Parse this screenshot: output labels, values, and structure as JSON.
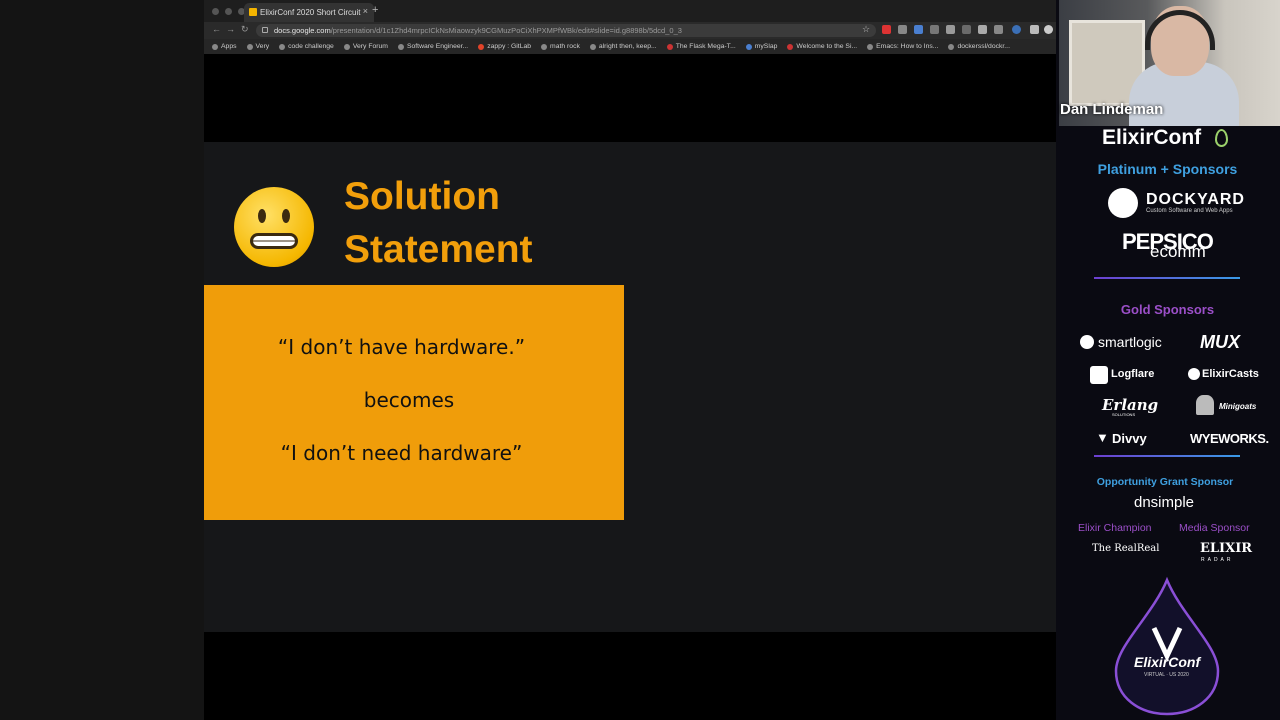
{
  "browser": {
    "tab_title": "ElixirConf 2020 Short Circuit",
    "tab_close": "×",
    "new_tab": "+",
    "url_host": "docs.google.com",
    "url_path": "/presentation/d/1c1Zhd4mrpcICkNsMiaowzyk9CGMuzPoCiXhPXMPfWBk/edit#slide=id.g8898b/5dcd_0_3",
    "bookmarks": [
      "Apps",
      "Very",
      "code challenge",
      "Very Forum",
      "Software Engineer...",
      "zappy : GitLab",
      "math rock",
      "alright then, keep...",
      "The Flask Mega-T...",
      "mySlap",
      "Welcome to the Si...",
      "Emacs: How to Ins...",
      "dockerssl/dockr..."
    ]
  },
  "slide": {
    "title_line1": "Solution",
    "title_line2": "Statement",
    "quote1": "“I don’t have hardware.”",
    "middle": "becomes",
    "quote2": "“I don’t need hardware”",
    "title_color": "#f29f0b",
    "box_color": "#f09d0a"
  },
  "sidebar": {
    "speaker_name": "Dan Lindeman",
    "conf_logo": "ElixirConf",
    "platinum_heading": "Platinum + Sponsors",
    "dockyard": "DOCKYARD",
    "dockyard_tagline": "Custom Software and Web Apps",
    "pepsico": "PEPSICO",
    "ecomm": "ecomm",
    "gold_heading": "Gold Sponsors",
    "gold_sponsors": [
      "smartlogic",
      "MUX",
      "Logflare",
      "ElixirCasts",
      "Erlang",
      "Minigoats",
      "Divvy",
      "WYEWORKS."
    ],
    "erlang_sub": "SOLUTIONS",
    "opportunity_heading": "Opportunity Grant Sponsor",
    "dnsimple": "dnsimple",
    "champion_heading": "Elixir Champion",
    "media_heading": "Media Sponsor",
    "therealreal": "The RealReal",
    "elixir_radar": "ELIXIR",
    "radar_sub": "RADAR",
    "event_logo": "ElixirConf",
    "event_sub": "VIRTUAL · US 2020"
  }
}
